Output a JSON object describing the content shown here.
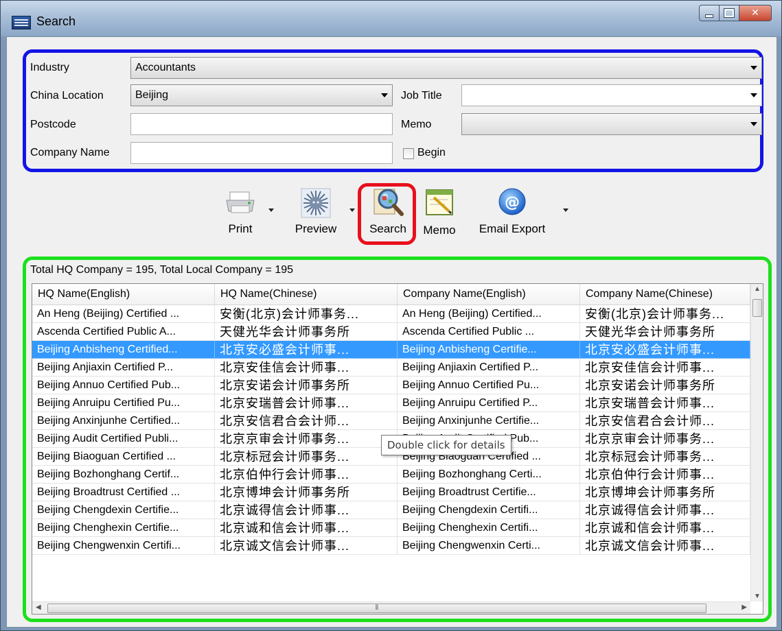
{
  "window": {
    "title": "Search"
  },
  "form": {
    "industry_label": "Industry",
    "industry_value": "Accountants",
    "location_label": "China Location",
    "location_value": "Beijing",
    "job_title_label": "Job Title",
    "job_title_value": "",
    "postcode_label": "Postcode",
    "postcode_value": "",
    "memo_label": "Memo",
    "memo_value": "",
    "company_label": "Company Name",
    "company_value": "",
    "begin_label": "Begin",
    "begin_checked": false
  },
  "toolbar": {
    "print_label": "Print",
    "preview_label": "Preview",
    "search_label": "Search",
    "memo_label": "Memo",
    "email_label": "Email Export"
  },
  "results": {
    "summary": "Total HQ Company = 195, Total Local Company = 195",
    "columns": [
      "HQ Name(English)",
      "HQ Name(Chinese)",
      "Company Name(English)",
      "Company Name(Chinese)"
    ],
    "rows": [
      [
        "An Heng (Beijing) Certified ...",
        "安衡(北京)会计师事务...",
        "An Heng (Beijing) Certified...",
        "安衡(北京)会计师事务..."
      ],
      [
        "Ascenda Certified Public A...",
        "天健光华会计师事务所",
        "Ascenda Certified Public ...",
        "天健光华会计师事务所"
      ],
      [
        "Beijing Anbisheng Certified...",
        "北京安必盛会计师事...",
        "Beijing Anbisheng Certifie...",
        "北京安必盛会计师事..."
      ],
      [
        "Beijing Anjiaxin Certified P...",
        "北京安佳信会计师事...",
        "Beijing Anjiaxin Certified P...",
        "北京安佳信会计师事..."
      ],
      [
        "Beijing Annuo Certified Pub...",
        "北京安诺会计师事务所",
        "Beijing Annuo Certified Pu...",
        "北京安诺会计师事务所"
      ],
      [
        "Beijing Anruipu Certified Pu...",
        "北京安瑞普会计师事...",
        "Beijing Anruipu Certified P...",
        "北京安瑞普会计师事..."
      ],
      [
        "Beijing Anxinjunhe Certified...",
        "北京安信君合会计师...",
        "Beijing Anxinjunhe Certifie...",
        "北京安信君合会计师..."
      ],
      [
        "Beijing Audit Certified Publi...",
        "北京京审会计师事务...",
        "Beijing Audit Certified Pub...",
        "北京京审会计师事务..."
      ],
      [
        "Beijing Biaoguan Certified ...",
        "北京标冠会计师事务...",
        "Beijing Biaoguan Certified ...",
        "北京标冠会计师事务..."
      ],
      [
        "Beijing Bozhonghang Certif...",
        "北京伯仲行会计师事...",
        "Beijing Bozhonghang Certi...",
        "北京伯仲行会计师事..."
      ],
      [
        "Beijing Broadtrust Certified ...",
        "北京博坤会计师事务所",
        "Beijing Broadtrust Certifie...",
        "北京博坤会计师事务所"
      ],
      [
        "Beijing Chengdexin Certifie...",
        "北京诚得信会计师事...",
        "Beijing Chengdexin Certifi...",
        "北京诚得信会计师事..."
      ],
      [
        "Beijing Chenghexin Certifie...",
        "北京诚和信会计师事...",
        "Beijing Chenghexin Certifi...",
        "北京诚和信会计师事..."
      ],
      [
        "Beijing Chengwenxin Certifi...",
        "北京诚文信会计师事...",
        "Beijing Chengwenxin Certi...",
        "北京诚文信会计师事..."
      ]
    ],
    "selected_row": 2
  },
  "tooltip": "Double click for details",
  "colors": {
    "form_outline": "#1414e6",
    "search_highlight": "#e8101c",
    "results_outline": "#1ce01c",
    "selection": "#3399ff"
  },
  "icons": {
    "print": "printer-icon",
    "preview": "preview-icon",
    "search": "magnifier-icon",
    "memo": "notepad-icon",
    "email": "at-sign-icon"
  }
}
